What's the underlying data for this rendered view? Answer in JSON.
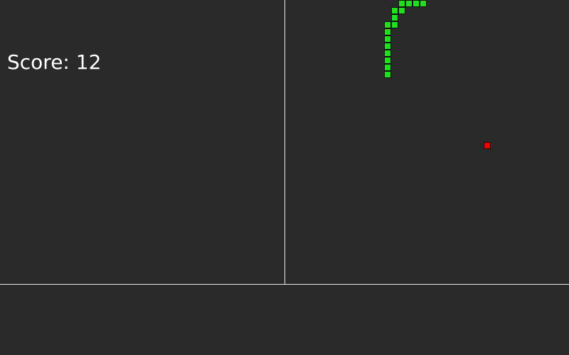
{
  "hud": {
    "score_text": "Score: 12"
  },
  "colors": {
    "background": "#2a2a2a",
    "divider": "#e8e8e8",
    "snake": "#22dd22",
    "food": "#ee0000",
    "score_text": "#ffffff"
  },
  "game": {
    "grid_cell_size": 10,
    "snake": [
      {
        "col": 19,
        "row": 0
      },
      {
        "col": 18,
        "row": 0
      },
      {
        "col": 17,
        "row": 0
      },
      {
        "col": 16,
        "row": 0
      },
      {
        "col": 16,
        "row": 1
      },
      {
        "col": 15,
        "row": 1
      },
      {
        "col": 15,
        "row": 2
      },
      {
        "col": 15,
        "row": 3
      },
      {
        "col": 14,
        "row": 3
      },
      {
        "col": 14,
        "row": 4
      },
      {
        "col": 14,
        "row": 5
      },
      {
        "col": 14,
        "row": 6
      },
      {
        "col": 14,
        "row": 7
      },
      {
        "col": 14,
        "row": 8
      },
      {
        "col": 14,
        "row": 9
      },
      {
        "col": 14,
        "row": 10
      }
    ],
    "food": {
      "col": 28,
      "row": 20
    }
  }
}
